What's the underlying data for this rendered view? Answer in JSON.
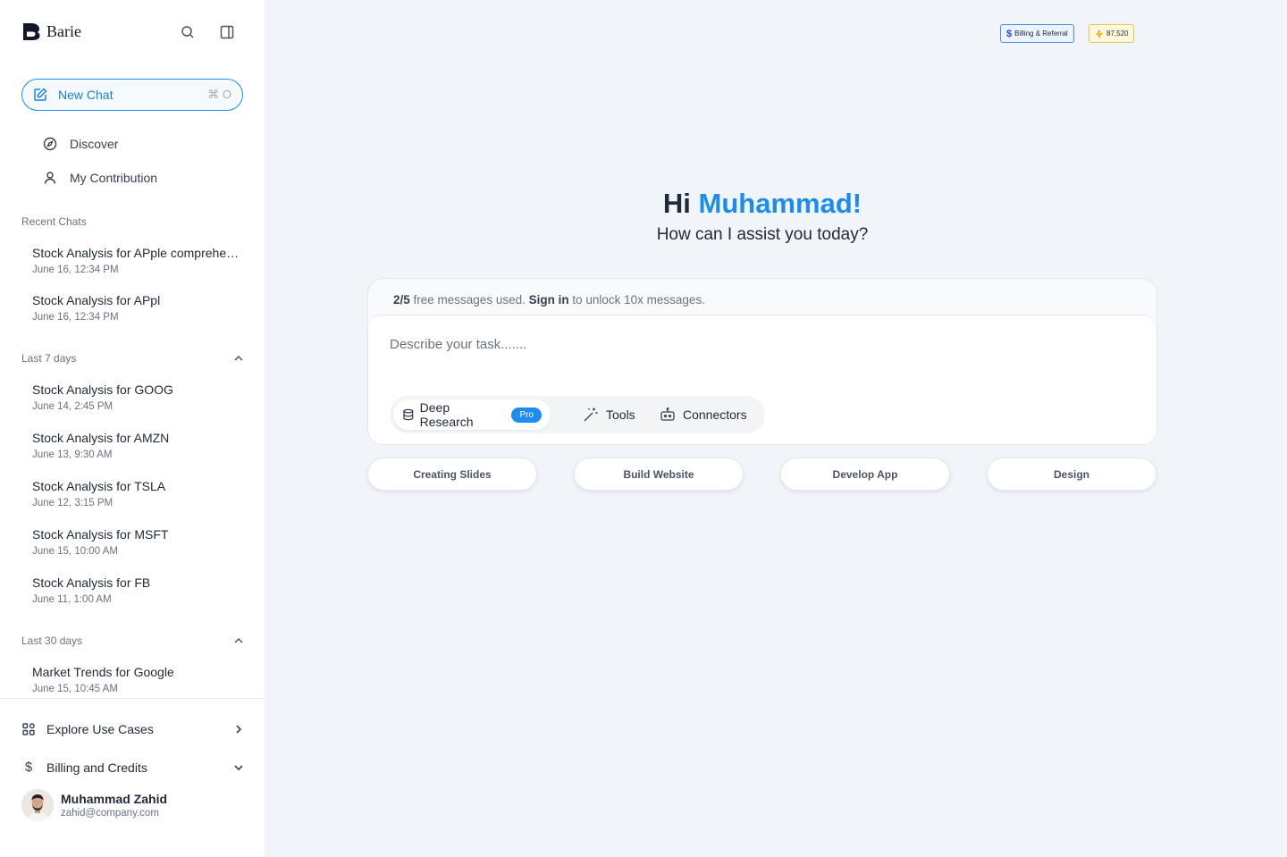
{
  "sidebar": {
    "logo_text": "Barie",
    "new_chat": {
      "label": "New Chat",
      "shortcut": "⌘ O"
    },
    "nav": [
      {
        "label": "Discover"
      },
      {
        "label": "My Contribution"
      }
    ],
    "recent": {
      "label": "Recent Chats",
      "items": [
        {
          "title": "Stock Analysis for APple comprehensive review",
          "date": "June 16, 12:34 PM"
        },
        {
          "title": "Stock Analysis for APpl",
          "date": "June 16, 12:34 PM"
        }
      ]
    },
    "last7": {
      "label": "Last 7 days",
      "items": [
        {
          "title": "Stock Analysis for GOOG",
          "date": "June 14, 2:45 PM"
        },
        {
          "title": "Stock Analysis for AMZN",
          "date": "June 13, 9:30 AM"
        },
        {
          "title": "Stock Analysis for TSLA",
          "date": "June 12, 3:15 PM"
        },
        {
          "title": "Stock Analysis for MSFT",
          "date": "June 15, 10:00 AM"
        },
        {
          "title": "Stock Analysis for FB",
          "date": "June 11, 1:00 AM"
        }
      ]
    },
    "last30": {
      "label": "Last 30 days",
      "items": [
        {
          "title": "Market Trends for Google",
          "date": "June 15, 10:45 AM"
        }
      ]
    },
    "explore_label": "Explore Use Cases",
    "billing_label": "Billing and Credits",
    "user": {
      "name": "Muhammad Zahid",
      "email": "zahid@company.com"
    }
  },
  "header": {
    "billing_badge": "Billing & Referral",
    "credits_badge": "87,520"
  },
  "main": {
    "greeting_prefix": "Hi ",
    "greeting_name": "Muhammad!",
    "subtitle": "How can I assist you today?",
    "usage": {
      "count": "2/5",
      "text": " free messages used. ",
      "signin": "Sign in",
      "suffix": " to unlock 10x messages."
    },
    "input_placeholder": "Describe your task.......",
    "tools": {
      "deep_research": "Deep Research",
      "pro": "Pro",
      "tools": "Tools",
      "connectors": "Connectors"
    },
    "suggestions": [
      "Creating  Slides",
      "Build Website",
      "Develop App",
      "Design"
    ]
  },
  "colors": {
    "accent": "#1d8cf0",
    "background": "#f1f4f9",
    "credits_border": "#e7c65a"
  }
}
